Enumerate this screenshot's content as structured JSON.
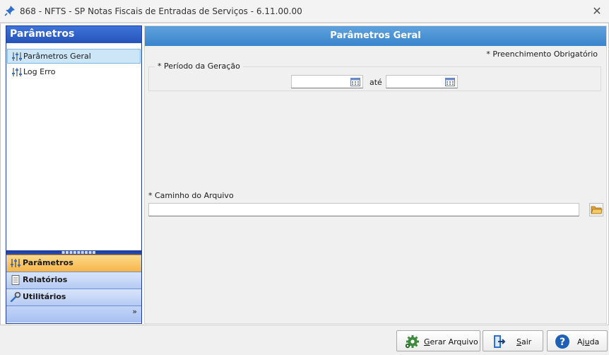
{
  "window": {
    "title": "868 - NFTS - SP  Notas Fiscais de Entradas de Serviços - 6.11.00.00",
    "close_glyph": "✕"
  },
  "left_panel": {
    "header": "Parâmetros",
    "tree_items": [
      {
        "label": "Parâmetros Geral",
        "icon": "sliders-icon",
        "selected": true
      },
      {
        "label": "Log Erro",
        "icon": "sliders-icon",
        "selected": false
      }
    ],
    "nav_buttons": [
      {
        "label": "Parâmetros",
        "icon": "sliders-icon",
        "active": true
      },
      {
        "label": "Relatórios",
        "icon": "report-icon",
        "active": false
      },
      {
        "label": "Utilitários",
        "icon": "wrench-icon",
        "active": false
      }
    ],
    "overflow_glyph": "»"
  },
  "main": {
    "title": "Parâmetros Geral",
    "required_note": "* Preenchimento Obrigatório",
    "period": {
      "label": "* Período da Geração",
      "from_value": "",
      "separator": "até",
      "to_value": ""
    },
    "path": {
      "label": "* Caminho do Arquivo",
      "value": ""
    }
  },
  "footer": {
    "generate_first": "G",
    "generate_rest": "erar Arquivo",
    "exit_first": "S",
    "exit_rest": "air",
    "help_head": "Aj",
    "help_u": "u",
    "help_tail": "da"
  },
  "colors": {
    "left_header": "#2553b8",
    "panel_title": "#3a84cc",
    "active_nav": "#f7b549",
    "selected_row": "#cde6f7"
  }
}
